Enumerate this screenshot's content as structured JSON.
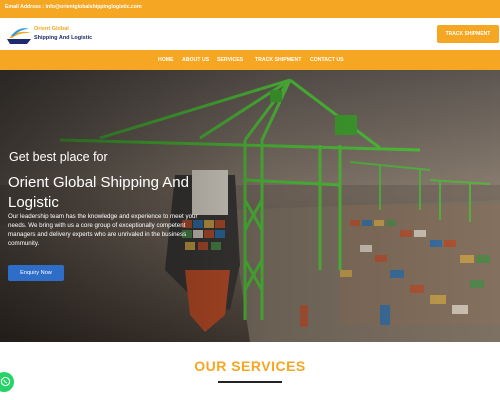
{
  "topbar": {
    "email": "Email Address : info@orientglobalshippinglogistic.com"
  },
  "header": {
    "logo_line1": "Orient Global",
    "logo_line2": "Shipping And Logistic",
    "track_button": "TRACK SHIPMENT"
  },
  "nav": {
    "items": [
      "HOME",
      "ABOUT US",
      "SERVICES",
      "TRACK SHIPMENT",
      "CONTACT US"
    ]
  },
  "hero": {
    "subtitle": "Get best place for",
    "title": "Orient Global Shipping And Logistic",
    "description": "Our leadership team has the knowledge and experience to meet your needs. We bring with us a core group of exceptionally competent managers and delivery experts who are unrivaled in the business community.",
    "button": "Enquiry Now"
  },
  "services": {
    "title": "OUR SERVICES"
  },
  "colors": {
    "accent": "#f5a623",
    "button_blue": "#2e6ec9",
    "whatsapp": "#25d366"
  },
  "icons": {
    "whatsapp": "whatsapp-icon",
    "logo": "ship-logo-icon"
  }
}
